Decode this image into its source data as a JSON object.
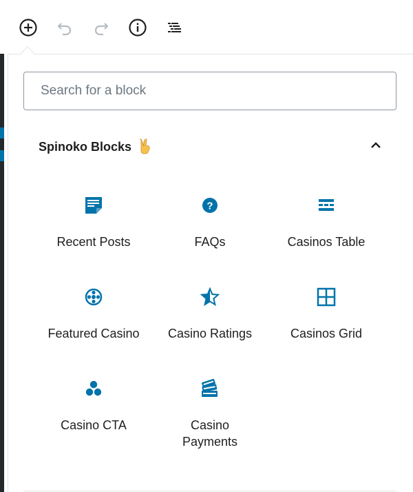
{
  "toolbar": {
    "add_block_icon": "plus-circle-icon",
    "undo_icon": "undo-icon",
    "redo_icon": "redo-icon",
    "info_icon": "info-icon",
    "outline_icon": "list-outline-icon"
  },
  "search": {
    "placeholder": "Search for a block",
    "value": ""
  },
  "panel": {
    "title": "Spinoko Blocks",
    "emoji": "✌",
    "toggle_icon": "chevron-up-icon"
  },
  "blocks": [
    {
      "label": "Recent Posts",
      "icon": "post-list-icon"
    },
    {
      "label": "FAQs",
      "icon": "question-circle-icon"
    },
    {
      "label": "Casinos Table",
      "icon": "table-rows-icon"
    },
    {
      "label": "Featured Casino",
      "icon": "roulette-wheel-icon"
    },
    {
      "label": "Casino Ratings",
      "icon": "star-half-icon"
    },
    {
      "label": "Casinos Grid",
      "icon": "grid-icon"
    },
    {
      "label": "Casino CTA",
      "icon": "chips-icon"
    },
    {
      "label": "Casino Payments",
      "icon": "payment-cards-icon"
    }
  ],
  "colors": {
    "accent": "#0073aa",
    "text": "#1e1e1e",
    "muted_icon": "#b5bcc2"
  }
}
